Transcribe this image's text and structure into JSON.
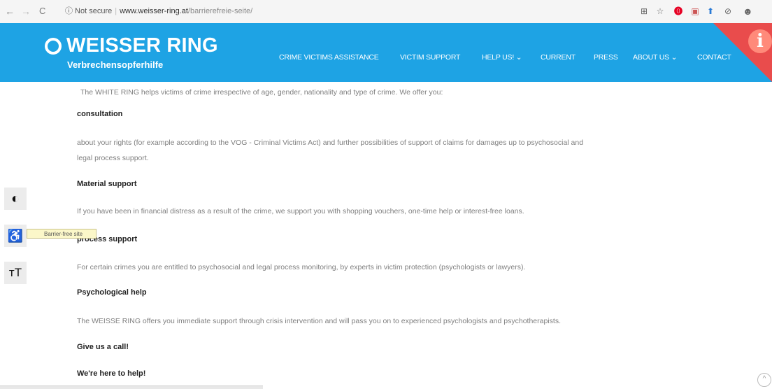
{
  "browser": {
    "back_icon": "←",
    "forward_icon": "→",
    "reload_icon": "C",
    "security_label": "ⓘ Not secure",
    "url_host": "www.weisser-ring.at",
    "url_path": "/barrierefreie-seite/",
    "extensions": [
      "translate-icon",
      "star-icon",
      "pinterest-icon",
      "extension-icon",
      "extension-icon",
      "block-icon",
      "profile-icon"
    ]
  },
  "site": {
    "name": "WEISSER RING",
    "tagline": "Verbrechensopferhilfe",
    "menu": [
      {
        "label": "CRIME VICTIMS ASSISTANCE"
      },
      {
        "label": "VICTIM SUPPORT"
      },
      {
        "label": "HELP US! ⌄"
      },
      {
        "label": "CURRENT"
      },
      {
        "label": "PRESS"
      },
      {
        "label": "ABOUT US ⌄"
      },
      {
        "label": "CONTACT"
      }
    ],
    "info_symbol": "i"
  },
  "content": {
    "intro": "The WHITE RING helps victims of crime irrespective of age, gender, nationality and type of crime. We offer you:",
    "consultation_heading": "consultation",
    "consultation_text_1": "about your rights (for example according to the VOG - Criminal Victims Act) and further possibilities of support of claims for damages up to psychosocial and",
    "consultation_text_2": "legal process support.",
    "material_heading": "Material support",
    "material_text": "If you have been in financial distress as a result of the crime, we support you with shopping vouchers, one-time help or interest-free loans.",
    "process_heading": "process support",
    "process_text": "For certain crimes you are entitled to psychosocial and legal process monitoring, by experts in victim protection (psychologists or lawyers).",
    "psych_heading": "Psychological help",
    "psych_text": "The WEISSE RING offers you immediate support through crisis intervention and will pass you on to experienced psychologists and psychotherapists.",
    "call_heading": "Give us a call!",
    "help_heading": "We're here to help!"
  },
  "accessibility": {
    "contrast_icon": "◐",
    "wheelchair_icon": "♿",
    "text_size_icon": "тT",
    "tooltip": "Barrier-free site"
  },
  "scroll_top_icon": "^"
}
